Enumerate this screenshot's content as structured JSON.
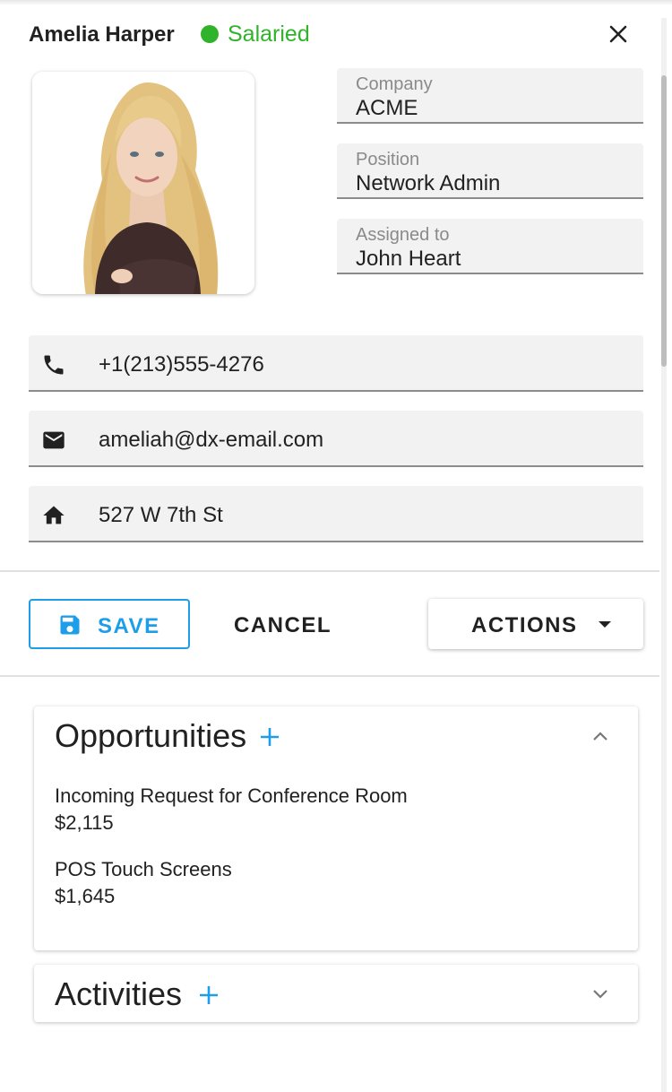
{
  "header": {
    "name": "Amelia Harper",
    "status": "Salaried",
    "status_color": "#2fb32a"
  },
  "profile": {
    "company": {
      "label": "Company",
      "value": "ACME"
    },
    "position": {
      "label": "Position",
      "value": "Network Admin"
    },
    "assigned": {
      "label": "Assigned to",
      "value": "John Heart"
    }
  },
  "contact": {
    "phone": {
      "icon": "phone-icon",
      "value": "+1(213)555-4276"
    },
    "email": {
      "icon": "email-icon",
      "value": "ameliah@dx-email.com"
    },
    "address": {
      "icon": "home-icon",
      "value": "527 W 7th St"
    }
  },
  "toolbar": {
    "save_label": "SAVE",
    "cancel_label": "CANCEL",
    "actions_label": "ACTIONS",
    "accent": "#1e9ee8"
  },
  "opportunities": {
    "title": "Opportunities",
    "items": [
      {
        "name": "Incoming Request for Conference Room",
        "amount": "$2,115"
      },
      {
        "name": "POS Touch Screens",
        "amount": "$1,645"
      }
    ]
  },
  "activities": {
    "title": "Activities"
  }
}
